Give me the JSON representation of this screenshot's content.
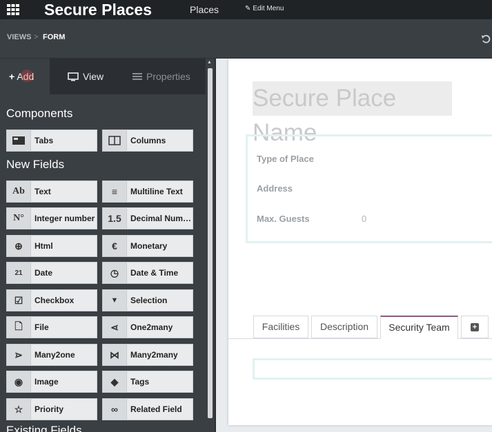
{
  "topbar": {
    "app_title": "Secure Places",
    "menu_places": "Places",
    "menu_edit": "Edit Menu",
    "icons": [
      "apps-grid-icon",
      "pencil-icon"
    ]
  },
  "breadcrumb": {
    "views": "VIEWS",
    "separator": ">",
    "form": "FORM",
    "icons": [
      "undo-icon"
    ]
  },
  "sidebar": {
    "tabs": [
      {
        "label": "Add",
        "icon": "plus-icon",
        "active": true
      },
      {
        "label": "View",
        "icon": "monitor-icon",
        "active": false
      },
      {
        "label": "Properties",
        "icon": "properties-icon",
        "active": false
      }
    ],
    "components_title": "Components",
    "components": [
      {
        "label": "Tabs",
        "icon": "tabs-icon"
      },
      {
        "label": "Columns",
        "icon": "columns-icon"
      }
    ],
    "new_fields_title": "New Fields",
    "new_fields": [
      {
        "label": "Text",
        "icon_text": "Ab",
        "icon": "text-field-icon"
      },
      {
        "label": "Multiline Text",
        "icon_text": "≡",
        "icon": "multiline-text-icon"
      },
      {
        "label": "Integer number",
        "icon_text": "N°",
        "icon": "integer-icon"
      },
      {
        "label": "Decimal Number",
        "icon_text": "1.5",
        "icon": "decimal-icon"
      },
      {
        "label": "Html",
        "icon_text": "⊕",
        "icon": "html-globe-icon"
      },
      {
        "label": "Monetary",
        "icon_text": "€",
        "icon": "monetary-icon"
      },
      {
        "label": "Date",
        "icon_text": "21",
        "icon": "calendar-icon"
      },
      {
        "label": "Date & Time",
        "icon_text": "◷",
        "icon": "calendar-clock-icon"
      },
      {
        "label": "Checkbox",
        "icon_text": "☑",
        "icon": "checkbox-icon"
      },
      {
        "label": "Selection",
        "icon_text": "▼",
        "icon": "selection-caret-icon"
      },
      {
        "label": "File",
        "icon_text": "🗋",
        "icon": "file-icon"
      },
      {
        "label": "One2many",
        "icon_text": "⋖",
        "icon": "one2many-icon"
      },
      {
        "label": "Many2one",
        "icon_text": "⋗",
        "icon": "many2one-icon"
      },
      {
        "label": "Many2many",
        "icon_text": "⋈",
        "icon": "many2many-icon"
      },
      {
        "label": "Image",
        "icon_text": "◉",
        "icon": "camera-icon"
      },
      {
        "label": "Tags",
        "icon_text": "◆",
        "icon": "tag-icon"
      },
      {
        "label": "Priority",
        "icon_text": "☆",
        "icon": "star-icon"
      },
      {
        "label": "Related Field",
        "icon_text": "∞",
        "icon": "link-icon"
      }
    ],
    "existing_fields_title": "Existing Fields"
  },
  "form": {
    "title_placeholder": "Secure Place Name",
    "fields": [
      {
        "label": "Type of Place",
        "value": ""
      },
      {
        "label": "Address",
        "value": ""
      },
      {
        "label": "Max. Guests",
        "value": "0"
      }
    ],
    "notebook_tabs": [
      {
        "label": "Facilities",
        "active": false
      },
      {
        "label": "Description",
        "active": false
      },
      {
        "label": "Security Team",
        "active": true
      }
    ],
    "colors": {
      "topbar": "#1f2326",
      "sidebar": "#3a3f44",
      "active_tab_accent": "#875a7b",
      "group_border": "#e2f1f1"
    }
  }
}
